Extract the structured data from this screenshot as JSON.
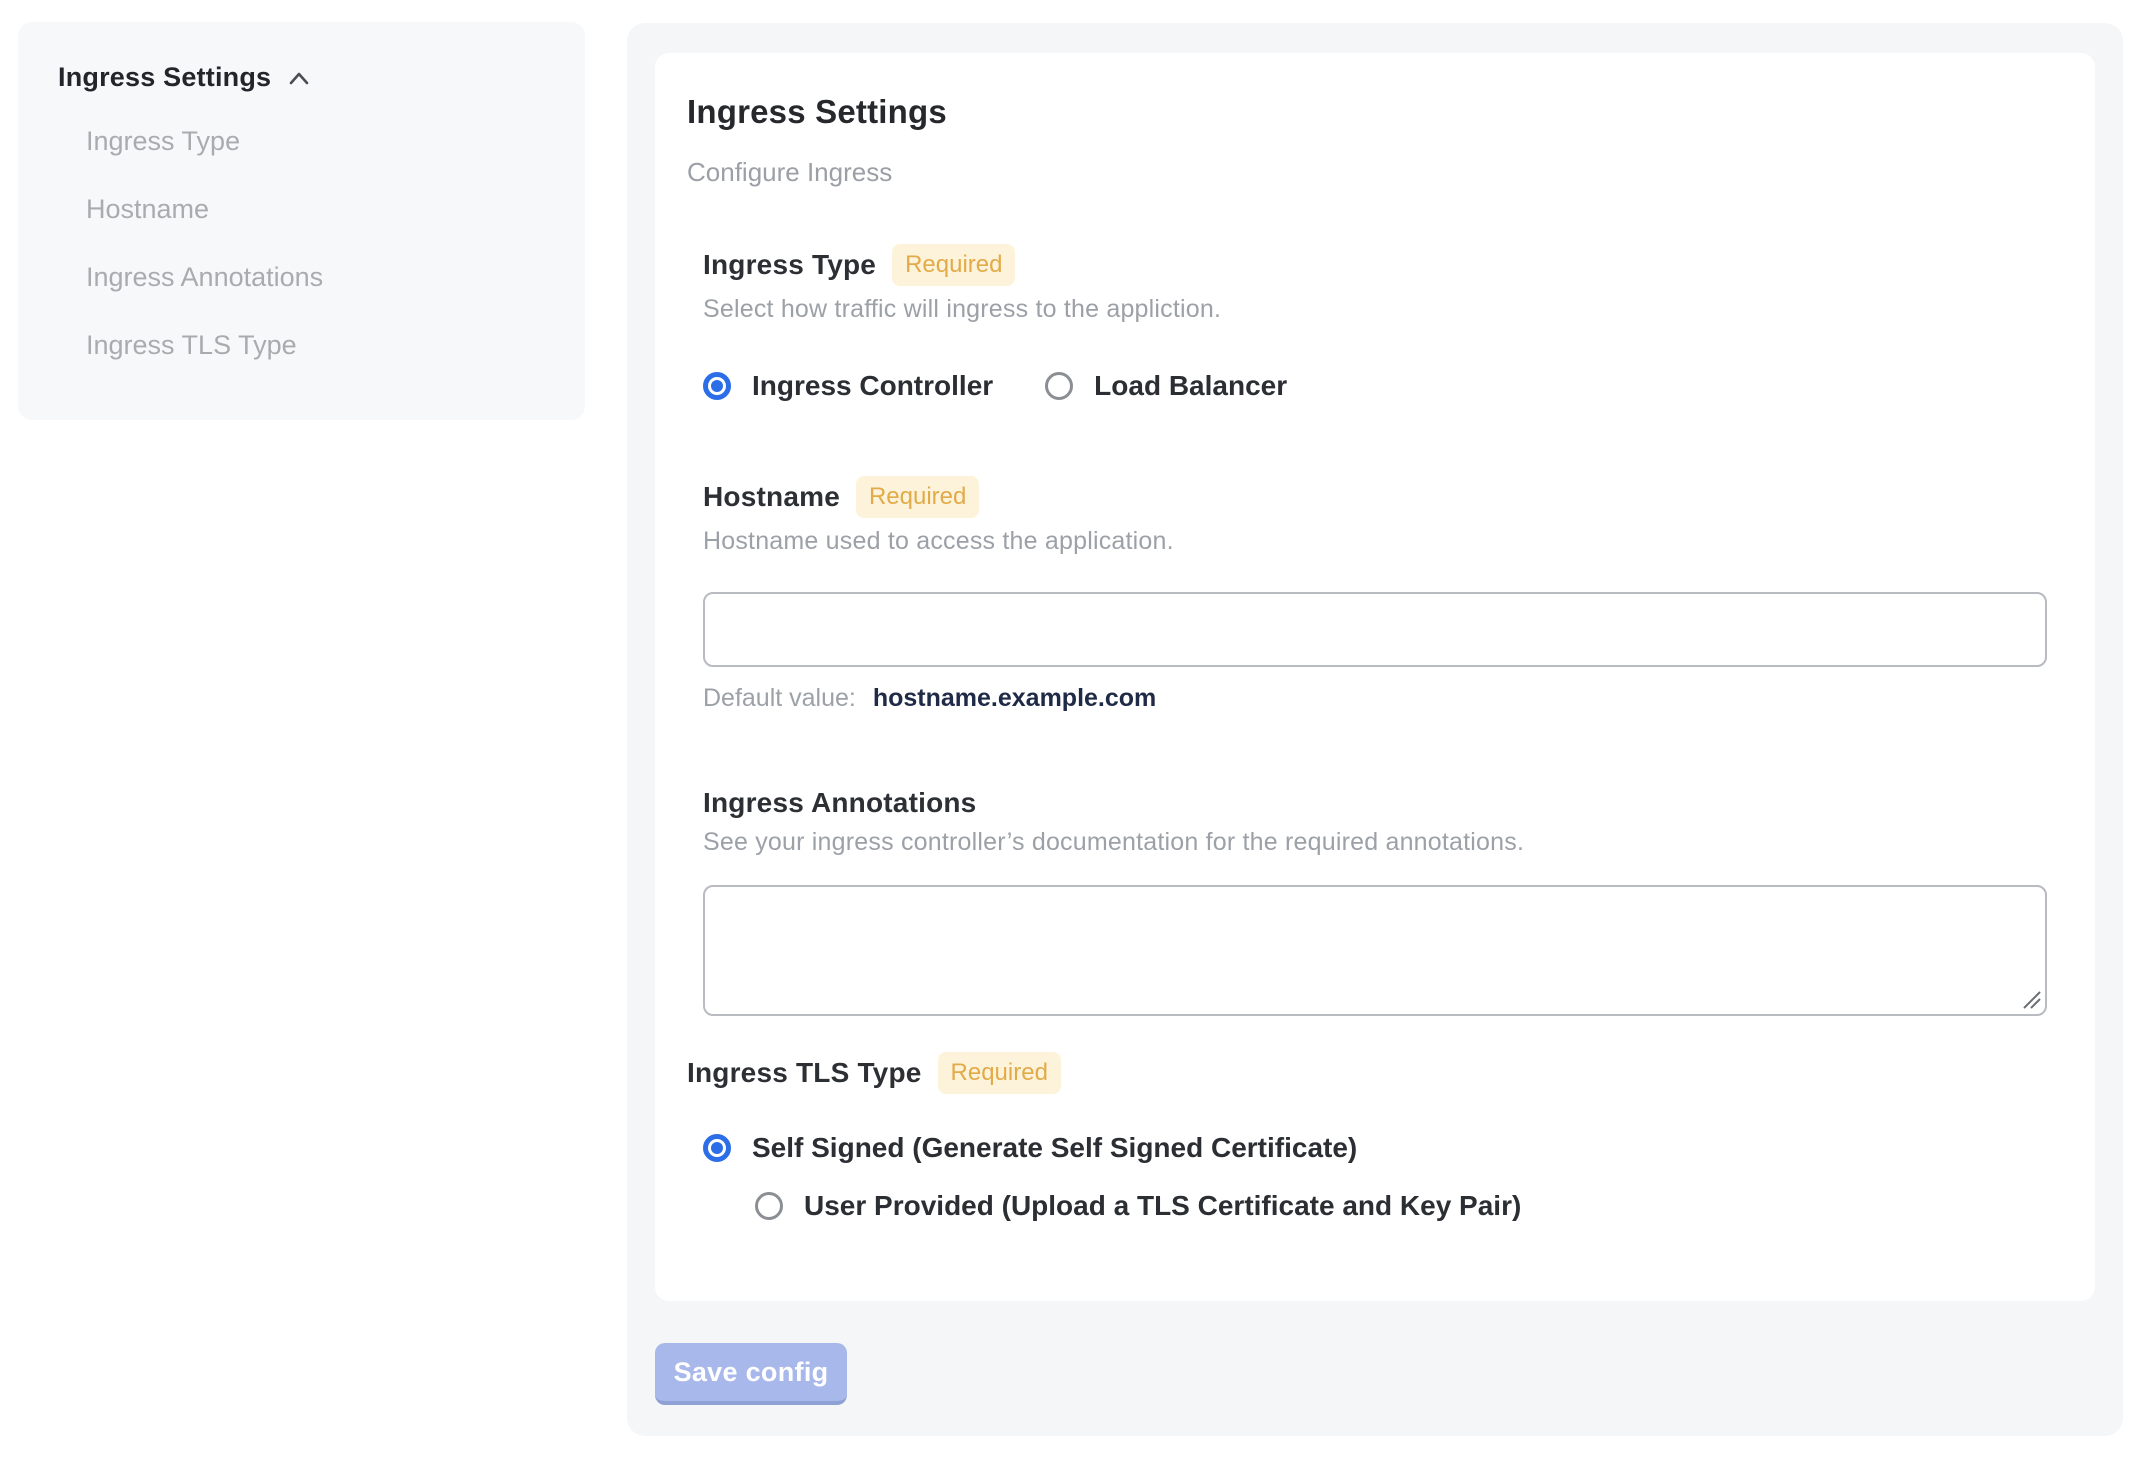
{
  "sidebar": {
    "title": "Ingress Settings",
    "items": [
      {
        "label": "Ingress Type"
      },
      {
        "label": "Hostname"
      },
      {
        "label": "Ingress Annotations"
      },
      {
        "label": "Ingress TLS Type"
      }
    ]
  },
  "main": {
    "title": "Ingress Settings",
    "subtitle": "Configure Ingress",
    "required_badge": "Required",
    "ingress_type": {
      "label": "Ingress Type",
      "required": true,
      "description": "Select how traffic will ingress to the appliction.",
      "options": [
        {
          "label": "Ingress Controller",
          "selected": true
        },
        {
          "label": "Load Balancer",
          "selected": false
        }
      ]
    },
    "hostname": {
      "label": "Hostname",
      "required": true,
      "description": "Hostname used to access the application.",
      "input_value": "",
      "default_prefix": "Default value:",
      "default_value": "hostname.example.com"
    },
    "annotations": {
      "label": "Ingress Annotations",
      "required": false,
      "description": "See your ingress controller’s documentation for the required annotations.",
      "textarea_value": ""
    },
    "tls": {
      "label": "Ingress TLS Type",
      "required": true,
      "options": [
        {
          "label": "Self Signed (Generate Self Signed Certificate)",
          "selected": true
        },
        {
          "label": "User Provided (Upload a TLS Certificate and Key Pair)",
          "selected": false
        }
      ]
    },
    "save_button": "Save config"
  },
  "colors": {
    "accent_blue": "#2c6ee8",
    "badge_bg": "#fcf3da",
    "badge_text": "#e2ab49",
    "panel_bg": "#f5f6f8",
    "sidebar_bg": "#f7f8f9",
    "button_bg": "#a9b8ea",
    "default_value_text": "#1f2a47"
  }
}
